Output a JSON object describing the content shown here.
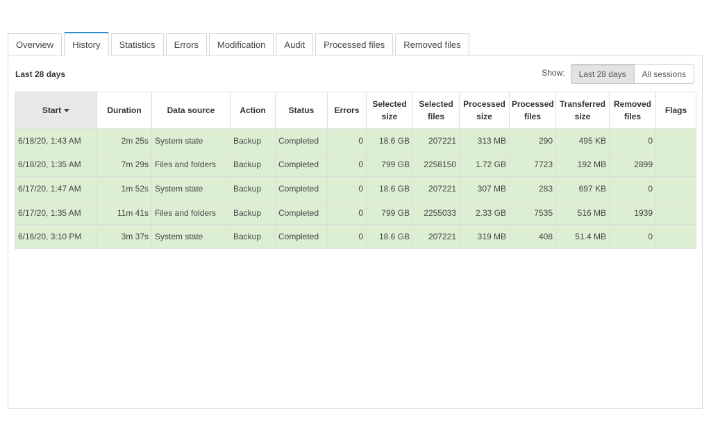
{
  "tabs": [
    "Overview",
    "History",
    "Statistics",
    "Errors",
    "Modification",
    "Audit",
    "Processed files",
    "Removed files"
  ],
  "active_tab": "History",
  "period_label": "Last 28 days",
  "show": {
    "label": "Show:",
    "options": [
      "Last 28 days",
      "All sessions"
    ],
    "selected": "Last 28 days"
  },
  "table": {
    "headers": [
      [
        "Start"
      ],
      [
        "Duration"
      ],
      [
        "Data source"
      ],
      [
        "Action"
      ],
      [
        "Status"
      ],
      [
        "Errors"
      ],
      [
        "Selected",
        "size"
      ],
      [
        "Selected",
        "files"
      ],
      [
        "Processed",
        "size"
      ],
      [
        "Processed",
        "files"
      ],
      [
        "Transferred",
        "size"
      ],
      [
        "Removed",
        "files"
      ],
      [
        "Flags"
      ]
    ],
    "sorted_column": "Start",
    "rows": [
      [
        "6/18/20, 1:43 AM",
        "2m 25s",
        "System state",
        "Backup",
        "Completed",
        "0",
        "18.6 GB",
        "207221",
        "313 MB",
        "290",
        "495 KB",
        "0",
        ""
      ],
      [
        "6/18/20, 1:35 AM",
        "7m 29s",
        "Files and folders",
        "Backup",
        "Completed",
        "0",
        "799 GB",
        "2258150",
        "1.72 GB",
        "7723",
        "192 MB",
        "2899",
        ""
      ],
      [
        "6/17/20, 1:47 AM",
        "1m 52s",
        "System state",
        "Backup",
        "Completed",
        "0",
        "18.6 GB",
        "207221",
        "307 MB",
        "283",
        "697 KB",
        "0",
        ""
      ],
      [
        "6/17/20, 1:35 AM",
        "11m 41s",
        "Files and folders",
        "Backup",
        "Completed",
        "0",
        "799 GB",
        "2255033",
        "2.33 GB",
        "7535",
        "516 MB",
        "1939",
        ""
      ],
      [
        "6/16/20, 3:10 PM",
        "3m 37s",
        "System state",
        "Backup",
        "Completed",
        "0",
        "18.6 GB",
        "207221",
        "319 MB",
        "408",
        "51.4 MB",
        "0",
        ""
      ]
    ]
  },
  "colors": {
    "accent": "#2f8ec9",
    "row_completed": "#dcefd3",
    "link": "#1a7fb6"
  }
}
